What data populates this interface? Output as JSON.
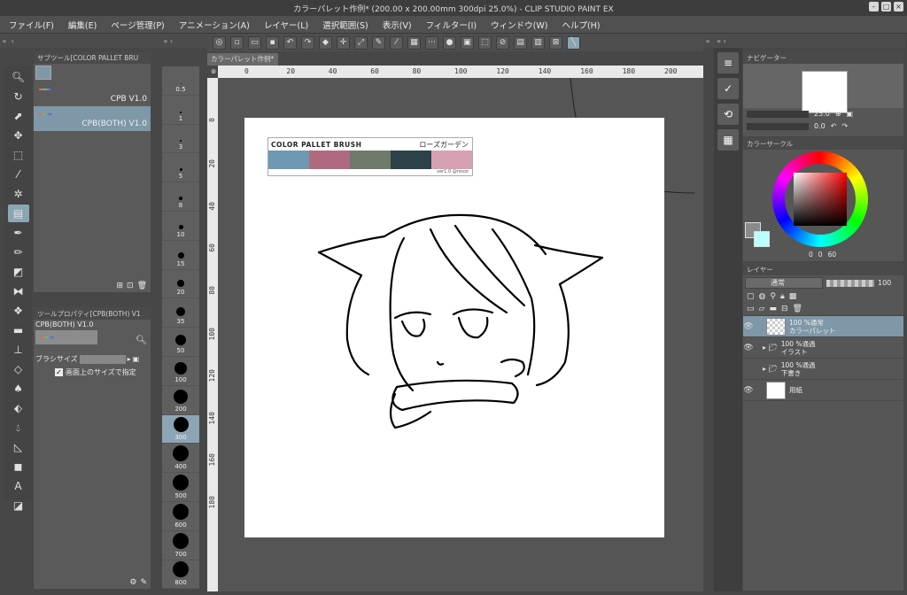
{
  "window": {
    "title": "カラーパレット作例* (200.00 x 200.00mm 300dpi 25.0%) - CLIP STUDIO PAINT EX"
  },
  "menu": [
    "ファイル(F)",
    "編集(E)",
    "ページ管理(P)",
    "アニメーション(A)",
    "レイヤー(L)",
    "選択範囲(S)",
    "表示(V)",
    "フィルター(I)",
    "ウィンドウ(W)",
    "ヘルプ(H)"
  ],
  "subtool_panel": {
    "header": "サブツール[COLOR PALLET BRU",
    "items": [
      {
        "label": "CPB V1.0"
      },
      {
        "label": "CPB(BOTH) V1.0"
      }
    ]
  },
  "tool_property": {
    "header": "ツールプロパティ[CPB(BOTH) V1",
    "name": "CPB(BOTH) V1.0",
    "brush_size_label": "ブラシサイズ",
    "checkbox_label": "画面上のサイズで指定"
  },
  "brush_sizes": [
    "0.5",
    "1",
    "3",
    "5",
    "8",
    "10",
    "15",
    "20",
    "35",
    "50",
    "100",
    "200",
    "300",
    "400",
    "500",
    "600",
    "700",
    "800"
  ],
  "brush_size_selected": "300",
  "document": {
    "tab": "カラーパレット作例*"
  },
  "ruler": {
    "top": [
      "0",
      "20",
      "40",
      "60",
      "80",
      "100",
      "120",
      "140",
      "160",
      "180",
      "200"
    ],
    "left": [
      "0",
      "20",
      "40",
      "60",
      "80",
      "100",
      "120",
      "140",
      "160",
      "180"
    ]
  },
  "palette_card": {
    "title": "COLOR PALLET BRUSH",
    "subtitle": "ローズガーデン",
    "version": "var1.0 @nisoo",
    "swatches": [
      "#6e98b4",
      "#b06a80",
      "#6f7a6c",
      "#2d4149",
      "#d7a0b3"
    ]
  },
  "navigator": {
    "header": "ナビゲーター",
    "zoom": "25.0",
    "rotation": "0.0"
  },
  "color_circle": {
    "header": "カラーサークル",
    "h": "0",
    "s": "0",
    "v": "60"
  },
  "layers": {
    "tab": "レイヤー",
    "blend_mode": "通常",
    "opacity": "100",
    "rows": [
      {
        "line1": "100 %通常",
        "line2": "カラーパレット",
        "type": "layer",
        "active": true
      },
      {
        "line1": "100 %通過",
        "line2": "イラスト",
        "type": "folder",
        "active": false
      },
      {
        "line1": "100 %通過",
        "line2": "下書き",
        "type": "folder",
        "active": false
      },
      {
        "line1": "",
        "line2": "用紙",
        "type": "paper",
        "active": false
      }
    ]
  }
}
